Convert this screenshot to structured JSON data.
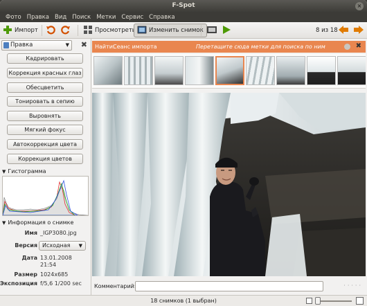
{
  "window": {
    "title": "F-Spot"
  },
  "menu": [
    "Фото",
    "Правка",
    "Вид",
    "Поиск",
    "Метки",
    "Сервис",
    "Справка"
  ],
  "toolbar": {
    "import_label": "Импорт",
    "browse_label": "Просмотреть",
    "edit_label": "Изменить снимок",
    "counter": "8 из 18"
  },
  "editor_panel": {
    "selected": "Правка",
    "buttons": [
      "Кадрировать",
      "Коррекция красных глаз",
      "Обесцветить",
      "Тонировать в сепию",
      "Выровнять",
      "Мягкий фокус",
      "Автокоррекция цвета",
      "Коррекция цветов"
    ]
  },
  "histogram": {
    "title": "Гистограмма"
  },
  "info": {
    "title": "Информация о снимке",
    "name_label": "Имя",
    "name_value": "_IGP3080.jpg",
    "version_label": "Версия",
    "version_value": "Исходная",
    "date_label": "Дата",
    "date_value": "13.01.2008",
    "time_value": "21:54",
    "size_label": "Размер",
    "size_value": "1024x685",
    "exposure_label": "Экспозиция",
    "exposure_value": "f/5,6 1/200 sec"
  },
  "findbar": {
    "label": "Найти:",
    "tag": "Сеанс импорта",
    "hint": "Перетащите сюда метки для поиска по ним"
  },
  "comment": {
    "label": "Комментарий:",
    "value": ""
  },
  "status": {
    "text": "18 снимков (1 выбран)"
  },
  "colors": {
    "findbar": "#e9864f",
    "titlebar": "#3c3b37"
  }
}
